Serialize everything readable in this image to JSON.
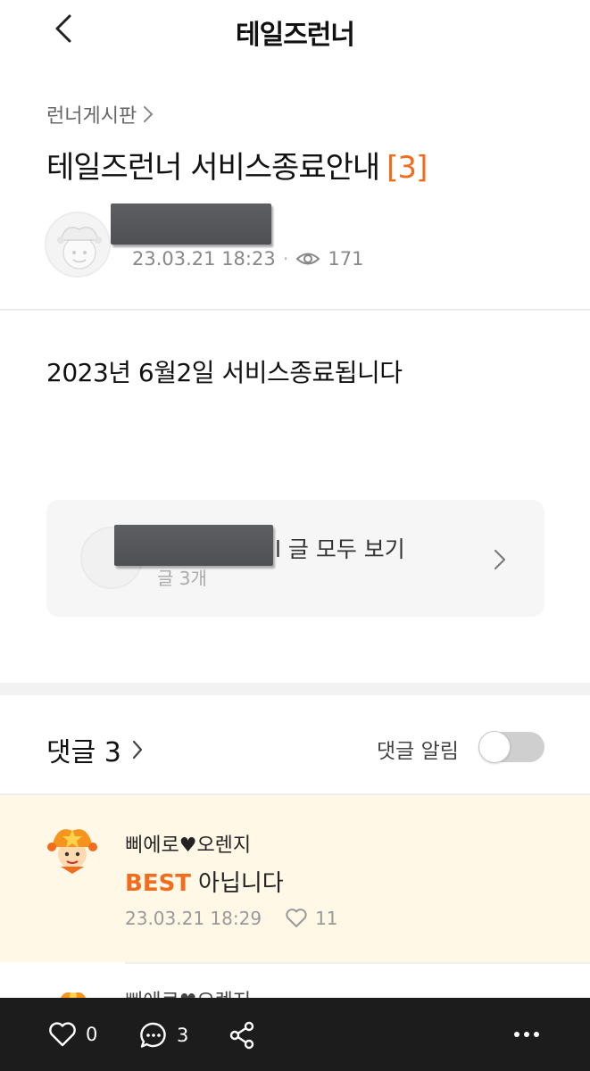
{
  "header": {
    "title": "테일즈런너",
    "back_icon": "chevron-left-icon"
  },
  "post": {
    "breadcrumb": "런너게시판",
    "title": "테일즈런너 서비스종료안내",
    "comment_count_tag": "[3]",
    "date": "23.03.21 18:23",
    "views": "171",
    "body": "2023년 6월2일 서비스종료됩니다"
  },
  "author_card": {
    "text": "l 글 모두 보기",
    "sub": "글 3개"
  },
  "comments": {
    "title": "댓글 3",
    "alarm_label": "댓글 알림",
    "alarm_on": false,
    "best": {
      "author": "삐에로♥오렌지",
      "badge": "BEST",
      "text": "아닙니다",
      "date": "23.03.21 18:29",
      "likes": "11"
    },
    "next_author": "삐에로♥오렌지"
  },
  "bottom_bar": {
    "likes": "0",
    "comments": "3"
  },
  "colors": {
    "accent": "#f26c1e",
    "best_bg": "#fff8e6",
    "bottom_bar": "#1c1c1c"
  }
}
